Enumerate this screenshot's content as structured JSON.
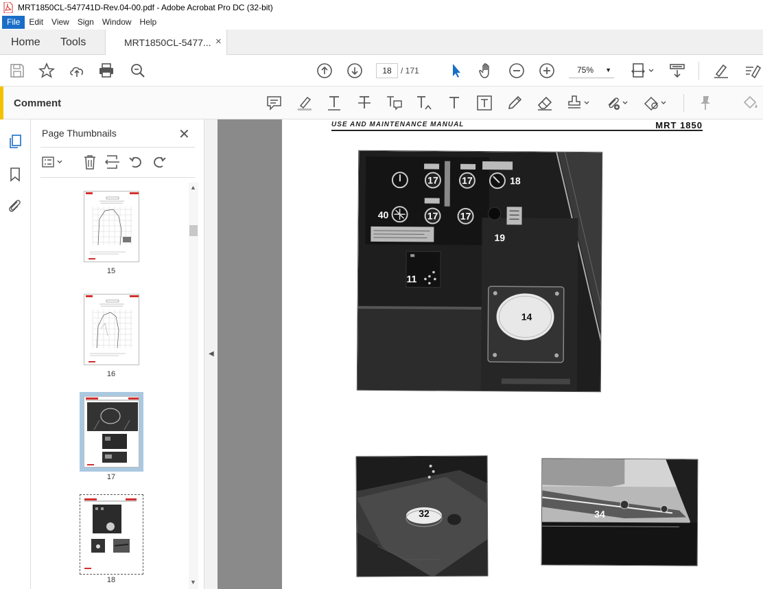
{
  "window": {
    "title": "MRT1850CL-547741D-Rev.04-00.pdf - Adobe Acrobat Pro DC (32-bit)"
  },
  "menu": [
    "File",
    "Edit",
    "View",
    "Sign",
    "Window",
    "Help"
  ],
  "tabs": {
    "home": "Home",
    "tools": "Tools",
    "document": "MRT1850CL-5477...",
    "close_glyph": "×"
  },
  "toolbar": {
    "current_page": "18",
    "total_pages": "/ 171",
    "zoom": "75%"
  },
  "comment_bar": {
    "title": "Comment"
  },
  "panel": {
    "title": "Page Thumbnails",
    "close_glyph": "✕",
    "thumbnails": [
      {
        "label": "15",
        "selected": false
      },
      {
        "label": "16",
        "selected": false
      },
      {
        "label": "17",
        "selected": true
      },
      {
        "label": "18",
        "selected": false
      }
    ]
  },
  "page": {
    "header_left": "USE AND MAINTENANCE MANUAL",
    "header_right": "MRT 1850",
    "callouts": {
      "c17a": "17",
      "c17b": "17",
      "c18": "18",
      "c40": "40",
      "c17c": "17",
      "c17d": "17",
      "c19": "19",
      "c11": "11",
      "c14": "14",
      "c32": "32",
      "c34": "34"
    }
  }
}
